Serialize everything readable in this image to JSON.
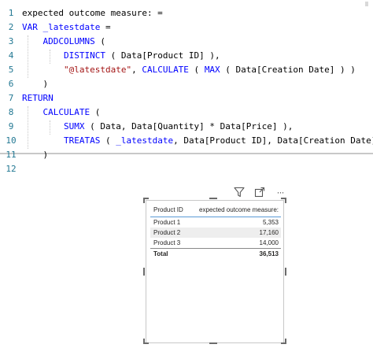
{
  "editor": {
    "lines": [
      {
        "n": "1",
        "parts": [
          {
            "t": "expected outcome measure: =",
            "c": "ref"
          }
        ]
      },
      {
        "n": "2",
        "parts": [
          {
            "t": "VAR ",
            "c": "kw"
          },
          {
            "t": "_latestdate",
            "c": "kw"
          },
          {
            "t": " =",
            "c": "ref"
          }
        ]
      },
      {
        "n": "3",
        "parts": [
          {
            "t": "    ADDCOLUMNS",
            "c": "fn"
          },
          {
            "t": " (",
            "c": "ref"
          }
        ]
      },
      {
        "n": "4",
        "parts": [
          {
            "t": "        DISTINCT",
            "c": "fn"
          },
          {
            "t": " ( Data[Product ID] ),",
            "c": "ref"
          }
        ]
      },
      {
        "n": "5",
        "parts": [
          {
            "t": "        ",
            "c": "ref"
          },
          {
            "t": "\"@latestdate\"",
            "c": "str"
          },
          {
            "t": ", ",
            "c": "ref"
          },
          {
            "t": "CALCULATE",
            "c": "fn"
          },
          {
            "t": " ( ",
            "c": "ref"
          },
          {
            "t": "MAX",
            "c": "fn"
          },
          {
            "t": " ( Data[Creation Date] ) )",
            "c": "ref"
          }
        ]
      },
      {
        "n": "6",
        "parts": [
          {
            "t": "    )",
            "c": "ref"
          }
        ]
      },
      {
        "n": "7",
        "parts": [
          {
            "t": "RETURN",
            "c": "kw"
          }
        ]
      },
      {
        "n": "8",
        "parts": [
          {
            "t": "    CALCULATE",
            "c": "fn"
          },
          {
            "t": " (",
            "c": "ref"
          }
        ]
      },
      {
        "n": "9",
        "parts": [
          {
            "t": "        SUMX",
            "c": "fn"
          },
          {
            "t": " ( Data, Data[Quantity] * Data[Price] ),",
            "c": "ref"
          }
        ]
      },
      {
        "n": "10",
        "parts": [
          {
            "t": "        TREATAS",
            "c": "fn"
          },
          {
            "t": " ( ",
            "c": "ref"
          },
          {
            "t": "_latestdate",
            "c": "kw"
          },
          {
            "t": ", Data[Product ID], Data[Creation Date] )",
            "c": "ref"
          }
        ]
      },
      {
        "n": "11",
        "parts": [
          {
            "t": "    )",
            "c": "ref"
          }
        ]
      },
      {
        "n": "12",
        "parts": []
      }
    ]
  },
  "visual_header": {
    "filter_icon": "filter-icon",
    "focus_icon": "focus-mode-icon",
    "more_icon": "more-options-icon",
    "more_glyph": "···"
  },
  "table": {
    "headers": [
      "Product ID",
      "expected outcome measure:"
    ],
    "rows": [
      [
        "Product 1",
        "5,353"
      ],
      [
        "Product 2",
        "17,160"
      ],
      [
        "Product 3",
        "14,000"
      ]
    ],
    "total": [
      "Total",
      "36,513"
    ]
  },
  "colors": {
    "keyword": "#0000ff",
    "string": "#a31515",
    "line_number": "#237893",
    "header_underline": "#5b9bd5"
  }
}
